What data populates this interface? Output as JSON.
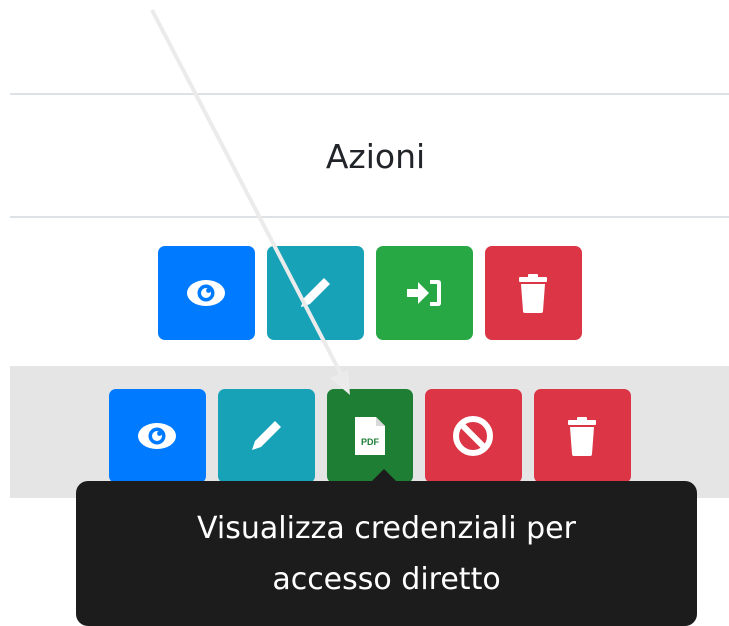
{
  "table": {
    "header": "Azioni"
  },
  "icons": {
    "view": "eye-icon",
    "edit": "pencil-icon",
    "login": "sign-in-icon",
    "pdf": "pdf-file-icon",
    "block": "ban-icon",
    "delete": "trash-icon"
  },
  "pdf_label": "PDF",
  "tooltip": {
    "line1": "Visualizza credenziali per",
    "line2": "accesso diretto"
  },
  "colors": {
    "primary": "#007bff",
    "info": "#17a2b8",
    "success": "#28a745",
    "success_hover": "#1e7e34",
    "danger": "#dc3545",
    "tooltip_bg": "#1c1c1c"
  }
}
